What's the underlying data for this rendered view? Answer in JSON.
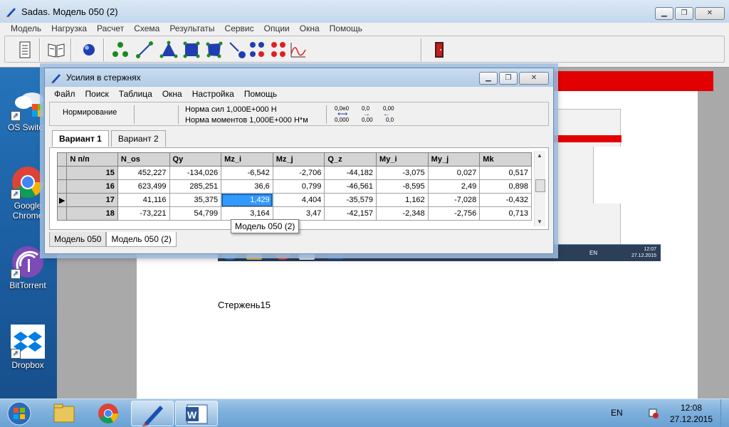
{
  "main_window": {
    "title": "Sadas. Модель 050 (2)",
    "menu": [
      "Модель",
      "Нагрузка",
      "Расчет",
      "Схема",
      "Результаты",
      "Сервис",
      "Опции",
      "Окна",
      "Помощь"
    ]
  },
  "desktop_icons": [
    {
      "label": "OS Switch",
      "icon": "os-switch-icon"
    },
    {
      "label": "Google Chrome",
      "icon": "chrome-icon"
    },
    {
      "label": "BitTorrent",
      "icon": "bittorrent-icon"
    },
    {
      "label": "Dropbox",
      "icon": "dropbox-icon"
    }
  ],
  "dialog": {
    "title": "Усилия в стержнях",
    "menu": [
      "Файл",
      "Поиск",
      "Таблица",
      "Окна",
      "Настройка",
      "Помощь"
    ],
    "norm_label": "Нормирование",
    "norm_force": "Норма сил 1,000E+000 Н",
    "norm_moment": "Норма моментов 1,000E+000 Н*м",
    "mini_icons": [
      "0,0e0",
      "0,0",
      "0,00",
      "0,000",
      "0,00",
      "0,0"
    ],
    "tabs": [
      "Вариант 1",
      "Вариант 2"
    ],
    "active_tab": 0,
    "columns": [
      "N п/п",
      "N_os",
      "Qy",
      "Mz_i",
      "Mz_j",
      "Q_z",
      "My_i",
      "My_j",
      "Mk"
    ],
    "rows": [
      {
        "n": "15",
        "values": [
          "452,227",
          "-134,026",
          "-6,542",
          "-2,706",
          "-44,182",
          "-3,075",
          "0,027",
          "0,517"
        ]
      },
      {
        "n": "16",
        "values": [
          "623,499",
          "285,251",
          "36,6",
          "0,799",
          "-46,561",
          "-8,595",
          "2,49",
          "0,898"
        ]
      },
      {
        "n": "17",
        "values": [
          "41,116",
          "35,375",
          "1,429",
          "4,404",
          "-35,579",
          "1,162",
          "-7,028",
          "-0,432"
        ]
      },
      {
        "n": "18",
        "values": [
          "-73,221",
          "54,799",
          "3,164",
          "3,47",
          "-42,157",
          "-2,348",
          "-2,756",
          "0,713"
        ]
      }
    ],
    "current_row": 2,
    "selected_col": 2,
    "bottom_tabs": [
      "Модель 050",
      "Модель 050 (2)"
    ],
    "active_bottom_tab": 1,
    "tooltip": "Модель 050 (2)"
  },
  "document": {
    "text": "Стержень15",
    "inner_taskbar": {
      "lang": "EN",
      "time": "12:07",
      "date": "27.12.2015"
    }
  },
  "taskbar": {
    "lang": "EN",
    "time": "12:08",
    "date": "27.12.2015"
  },
  "colors": {
    "selection": "#3399ff",
    "red_strip": "#e30000",
    "desktop": "#1c5fa3"
  }
}
